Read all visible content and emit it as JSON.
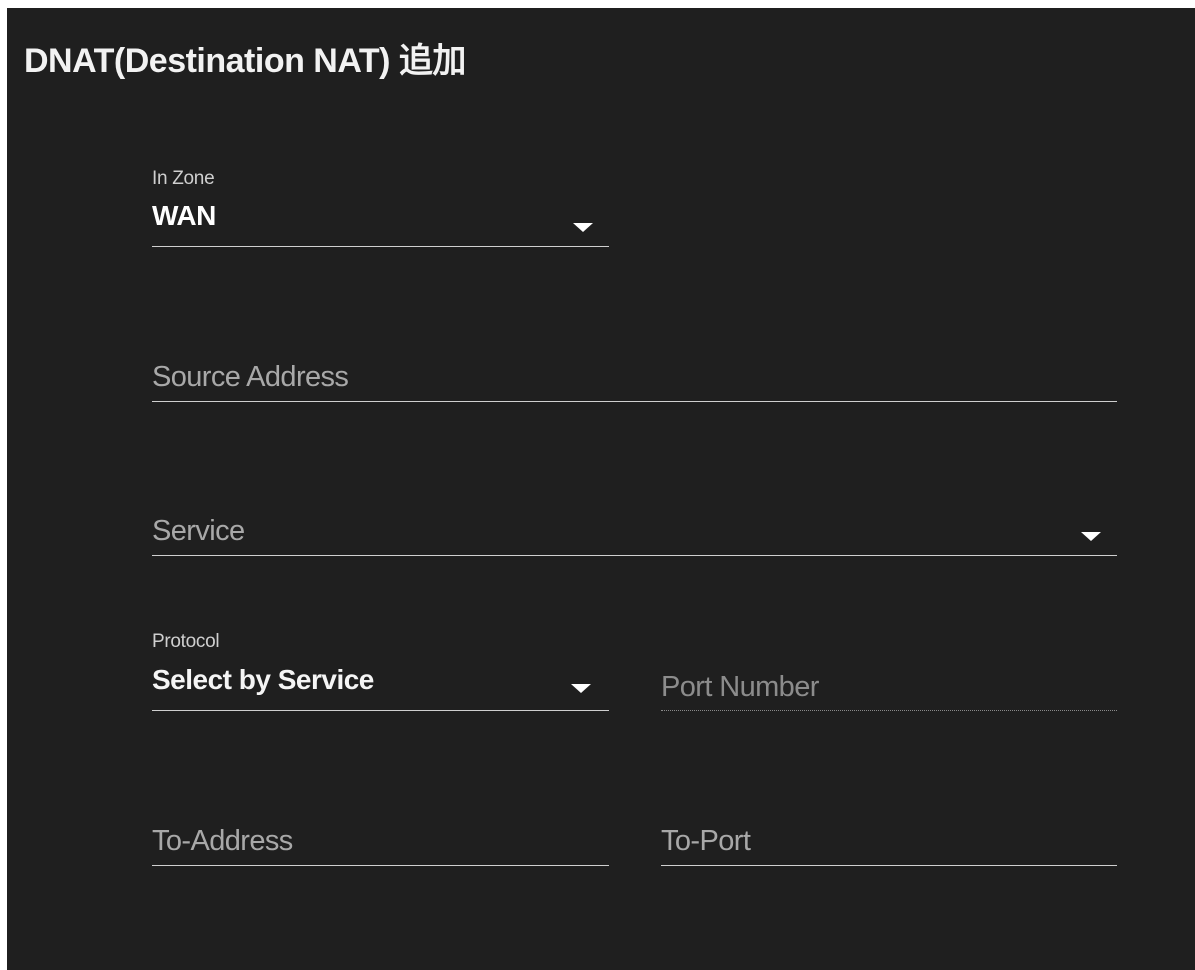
{
  "dialog": {
    "title": "DNAT(Destination NAT) 追加"
  },
  "form": {
    "in_zone": {
      "label": "In Zone",
      "value": "WAN",
      "icon": "chevron-down-icon"
    },
    "source_address": {
      "placeholder": "Source Address"
    },
    "service": {
      "placeholder": "Service",
      "icon": "chevron-down-icon"
    },
    "protocol": {
      "label": "Protocol",
      "value": "Select by Service",
      "icon": "chevron-down-icon"
    },
    "port_number": {
      "placeholder": "Port Number"
    },
    "to_address": {
      "placeholder": "To-Address"
    },
    "to_port": {
      "placeholder": "To-Port"
    }
  },
  "colors": {
    "dialog_background": "#1f1f1f",
    "text_primary": "#ffffff",
    "text_placeholder": "#a8a8a8",
    "underline": "#cfcfcf"
  }
}
